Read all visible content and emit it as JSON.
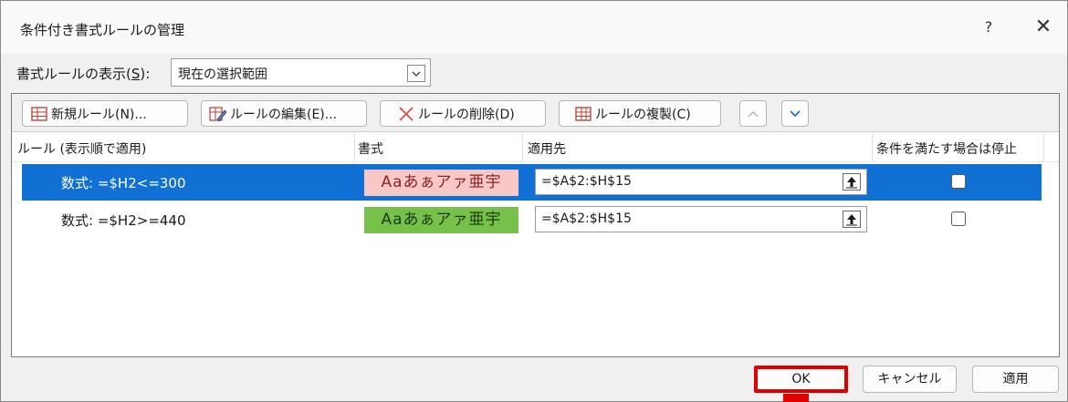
{
  "window": {
    "title": "条件付き書式ルールの管理",
    "help_label": "?",
    "close_label": "✕"
  },
  "scope": {
    "label_prefix": "書式ルールの表示(",
    "label_key": "S",
    "label_suffix": "):",
    "selected_value": "現在の選択範囲"
  },
  "toolbar": {
    "new_rule": "新規ルール(N)...",
    "edit_rule": "ルールの編集(E)...",
    "delete_rule": "ルールの削除(D)",
    "duplicate_rule": "ルールの複製(C)"
  },
  "columns": {
    "rule": "ルール (表示順で適用)",
    "format": "書式",
    "applies_to": "適用先",
    "stop_if_true": "条件を満たす場合は停止"
  },
  "rules": [
    {
      "formula": "数式: =$H2<=300",
      "preview": "Aaあぁアァ亜宇",
      "preview_bg": "#f8c8c8",
      "preview_fg": "#8b2323",
      "range": "=$A$2:$H$15",
      "stop_if_true": false,
      "selected": true
    },
    {
      "formula": "数式: =$H2>=440",
      "preview": "Aaあぁアァ亜宇",
      "preview_bg": "#77c14a",
      "preview_fg": "#1a3a10",
      "range": "=$A$2:$H$15",
      "stop_if_true": false,
      "selected": false
    }
  ],
  "footer": {
    "ok": "OK",
    "cancel": "キャンセル",
    "apply": "適用"
  },
  "colors": {
    "selection": "#1070d3",
    "highlight": "#e00000"
  }
}
